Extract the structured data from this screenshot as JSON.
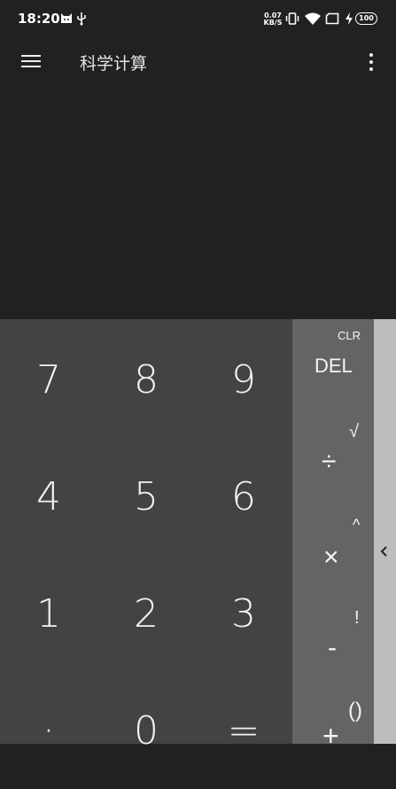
{
  "status_bar": {
    "time": "18:20",
    "net_speed_value": "0.07",
    "net_speed_unit": "KB/S",
    "battery_level": "100",
    "icons": [
      "cat-icon",
      "usb-icon",
      "vibrate-icon",
      "wifi-icon",
      "sim-icon",
      "charging-bolt-icon",
      "battery-icon"
    ]
  },
  "app_bar": {
    "title": "科学计算",
    "menu_icon": "hamburger-menu-icon",
    "more_icon": "more-vertical-icon"
  },
  "keypad": {
    "digits": [
      "7",
      "8",
      "9",
      "4",
      "5",
      "6",
      "1",
      "2",
      "3",
      "·",
      "0",
      "="
    ],
    "operators": {
      "clr": "CLR",
      "del": "DEL",
      "sqrt": "√",
      "divide": "÷",
      "caret": "^",
      "multiply": "×",
      "factorial": "!",
      "minus": "-",
      "paren": "()",
      "plus": "+"
    }
  },
  "side_panel": {
    "icon": "chevron-left-icon"
  },
  "colors": {
    "background": "#212121",
    "numpad": "#434343",
    "operators": "#646464",
    "side_panel": "#bdbdbd"
  }
}
